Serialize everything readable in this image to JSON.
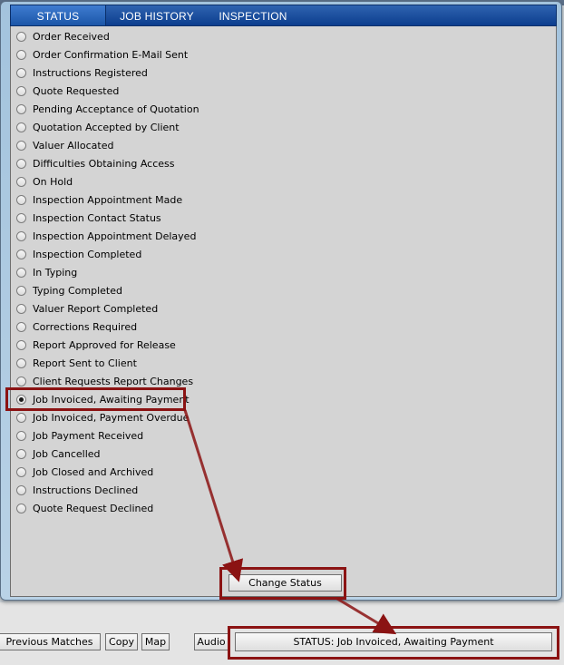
{
  "tabs": [
    {
      "label": "STATUS"
    },
    {
      "label": "JOB HISTORY"
    },
    {
      "label": "INSPECTION"
    }
  ],
  "status_options": [
    {
      "label": "Order Received",
      "selected": false
    },
    {
      "label": "Order Confirmation E-Mail Sent",
      "selected": false
    },
    {
      "label": "Instructions Registered",
      "selected": false
    },
    {
      "label": "Quote Requested",
      "selected": false
    },
    {
      "label": "Pending Acceptance of Quotation",
      "selected": false
    },
    {
      "label": "Quotation Accepted by Client",
      "selected": false
    },
    {
      "label": "Valuer Allocated",
      "selected": false
    },
    {
      "label": "Difficulties Obtaining Access",
      "selected": false
    },
    {
      "label": "On Hold",
      "selected": false
    },
    {
      "label": "Inspection Appointment Made",
      "selected": false
    },
    {
      "label": "Inspection Contact Status",
      "selected": false
    },
    {
      "label": "Inspection Appointment Delayed",
      "selected": false
    },
    {
      "label": "Inspection Completed",
      "selected": false
    },
    {
      "label": "In Typing",
      "selected": false
    },
    {
      "label": "Typing Completed",
      "selected": false
    },
    {
      "label": "Valuer Report Completed",
      "selected": false
    },
    {
      "label": "Corrections Required",
      "selected": false
    },
    {
      "label": "Report Approved for Release",
      "selected": false
    },
    {
      "label": "Report Sent to Client",
      "selected": false
    },
    {
      "label": "Client Requests Report Changes",
      "selected": false
    },
    {
      "label": "Job Invoiced, Awaiting Payment",
      "selected": true
    },
    {
      "label": "Job Invoiced, Payment Overdue",
      "selected": false
    },
    {
      "label": "Job Payment Received",
      "selected": false
    },
    {
      "label": "Job Cancelled",
      "selected": false
    },
    {
      "label": "Job Closed and Archived",
      "selected": false
    },
    {
      "label": "Instructions Declined",
      "selected": false
    },
    {
      "label": "Quote Request Declined",
      "selected": false
    }
  ],
  "change_status_button": "Change Status",
  "bottom_toolbar": {
    "previous_matches": "Previous Matches",
    "copy": "Copy",
    "map": "Map",
    "audio": "Audio",
    "status_display": "STATUS: Job Invoiced, Awaiting Payment"
  },
  "annotation_color": "#8b1313",
  "tab_bar_color": "#1b4f9e"
}
